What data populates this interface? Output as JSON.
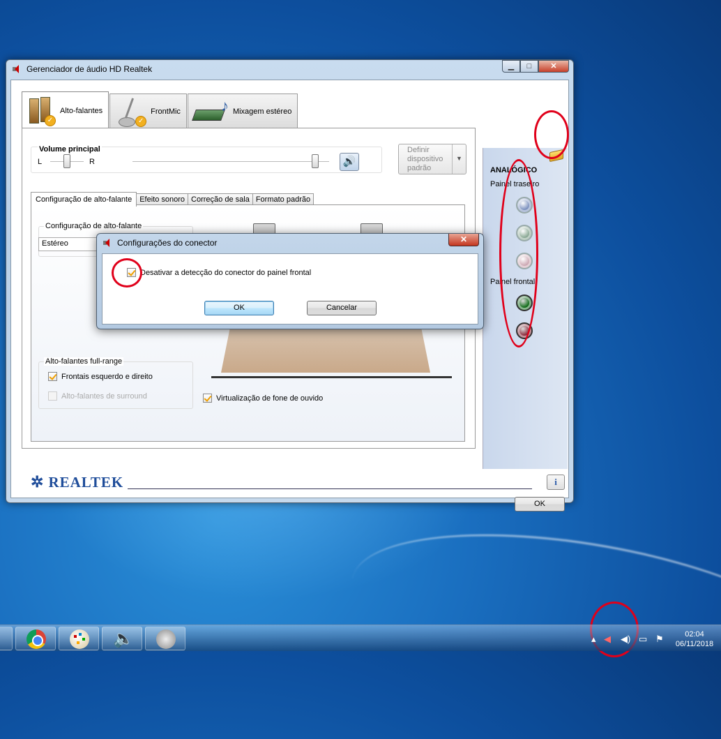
{
  "window": {
    "title": "Gerenciador de áudio HD Realtek",
    "min_label": "▁",
    "max_label": "□",
    "close_label": "✕"
  },
  "device_tabs": [
    {
      "label": "Alto-falantes",
      "icon": "speakers-icon",
      "active": true
    },
    {
      "label": "FrontMic",
      "icon": "microphone-icon",
      "active": false
    },
    {
      "label": "Mixagem estéreo",
      "icon": "stereo-mix-icon",
      "active": false
    }
  ],
  "volume": {
    "title": "Volume principal",
    "left_label": "L",
    "right_label": "R",
    "balance_level": 0.5,
    "volume_level": 0.93
  },
  "default_device": {
    "label_line1": "Definir",
    "label_line2": "dispositivo",
    "label_line3": "padrão"
  },
  "sub_tabs": [
    {
      "label": "Configuração de alto-falante",
      "active": true
    },
    {
      "label": "Efeito sonoro",
      "active": false
    },
    {
      "label": "Correção de sala",
      "active": false
    },
    {
      "label": "Formato padrão",
      "active": false
    }
  ],
  "speaker_config": {
    "group_title": "Configuração de alto-falante",
    "selected": "Estéreo"
  },
  "full_range": {
    "group_title": "Alto-falantes full-range",
    "front_label": "Frontais esquerdo e direito",
    "front_checked": true,
    "surround_label": "Alto-falantes de surround",
    "surround_checked": false,
    "surround_enabled": false
  },
  "headphone_virtualization": {
    "label": "Virtualização de fone de ouvido",
    "checked": true
  },
  "side_panel": {
    "heading": "ANALÓGICO",
    "rear_label": "Painel traseiro",
    "front_label": "Painel frontal",
    "rear_jacks": [
      "#6f86b8",
      "#7fa08a",
      "#c8a0ac"
    ],
    "front_jacks": [
      "#0e6a16",
      "#8a2a3a"
    ]
  },
  "brand": {
    "name": "REALTEK",
    "info_label": "i",
    "ok_label": "OK"
  },
  "dialog": {
    "title": "Configurações do conector",
    "checkbox_label": "Desativar a detecção do conector do painel frontal",
    "checkbox_checked": true,
    "ok_label": "OK",
    "cancel_label": "Cancelar",
    "close_label": "✕"
  },
  "taskbar": {
    "apps": [
      "chrome-icon",
      "paint-icon",
      "realtek-audio-icon",
      "sound-recorder-icon"
    ],
    "tray_icons": [
      "show-hidden-icon",
      "mute-speaker-icon",
      "volume-icon",
      "network-icon",
      "action-center-icon"
    ],
    "time": "02:04",
    "date": "06/11/2018"
  },
  "colors": {
    "annotation_red": "#e0001a",
    "brand_blue": "#1f4d9a"
  }
}
